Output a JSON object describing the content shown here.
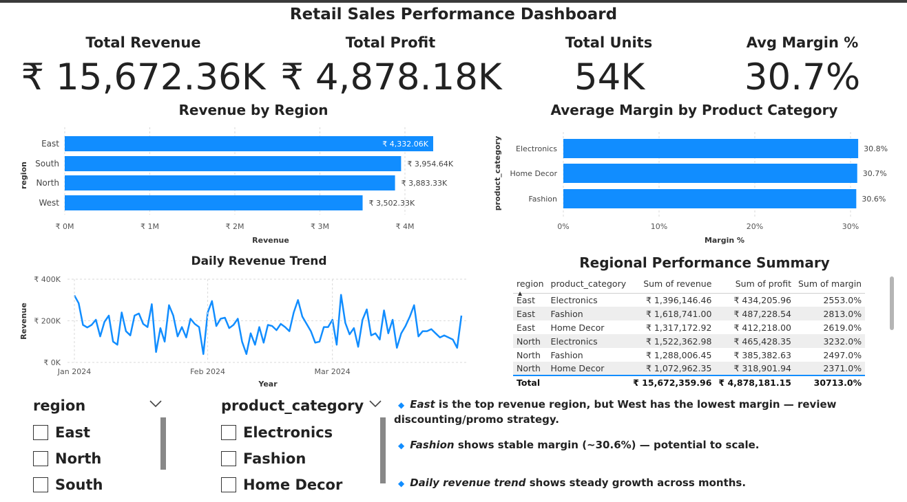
{
  "dashboard_title": "Retail Sales Performance Dashboard",
  "kpis": [
    {
      "label": "Total Revenue",
      "value": "₹ 15,672.36K"
    },
    {
      "label": "Total Profit",
      "value": "₹ 4,878.18K"
    },
    {
      "label": "Total Units",
      "value": "54K"
    },
    {
      "label": "Avg Margin %",
      "value": "30.7%"
    }
  ],
  "colors": {
    "accent": "#118DFF",
    "text": "#222222",
    "grid": "#d9d9d9",
    "band": "#eeeeee"
  },
  "charts": {
    "region": {
      "title": "Revenue by Region",
      "ylabel": "region",
      "xlabel": "Revenue",
      "x_ticks": [
        "₹ 0M",
        "₹ 1M",
        "₹ 2M",
        "₹ 3M",
        "₹ 4M"
      ],
      "bar_labels": [
        "₹ 4,332.06K",
        "₹ 3,954.64K",
        "₹ 3,883.33K",
        "₹ 3,502.33K"
      ]
    },
    "margin": {
      "title": "Average Margin by Product Category",
      "ylabel": "product_category",
      "xlabel": "Margin %",
      "x_ticks": [
        "0%",
        "10%",
        "20%",
        "30%"
      ],
      "bar_labels": [
        "30.8%",
        "30.7%",
        "30.6%"
      ]
    },
    "trend": {
      "title": "Daily Revenue Trend",
      "ylabel": "Revenue",
      "xlabel": "Year",
      "y_ticks": [
        "₹ 400K",
        "₹ 200K",
        "₹ 0K"
      ],
      "x_ticks": [
        "Jan 2024",
        "Feb 2024",
        "Mar 2024"
      ]
    }
  },
  "chart_data": [
    {
      "type": "bar",
      "orientation": "horizontal",
      "title": "Revenue by Region",
      "xlabel": "Revenue",
      "ylabel": "region",
      "categories": [
        "East",
        "South",
        "North",
        "West"
      ],
      "values": [
        4332.06,
        3954.64,
        3883.33,
        3502.33
      ],
      "unit": "₹ K",
      "xlim": [
        0,
        4500
      ],
      "grid": true
    },
    {
      "type": "bar",
      "orientation": "horizontal",
      "title": "Average Margin by Product Category",
      "xlabel": "Margin %",
      "ylabel": "product_category",
      "categories": [
        "Electronics",
        "Home Decor",
        "Fashion"
      ],
      "values": [
        30.8,
        30.7,
        30.6
      ],
      "xlim": [
        0,
        31
      ],
      "grid": true
    },
    {
      "type": "line",
      "title": "Daily Revenue Trend",
      "xlabel": "Year",
      "ylabel": "Revenue",
      "x": [
        "2024-01-01",
        "2024-01-02",
        "2024-01-03",
        "2024-01-04",
        "2024-01-05",
        "2024-01-06",
        "2024-01-07",
        "2024-01-08",
        "2024-01-09",
        "2024-01-10",
        "2024-01-11",
        "2024-01-12",
        "2024-01-13",
        "2024-01-14",
        "2024-01-15",
        "2024-01-16",
        "2024-01-17",
        "2024-01-18",
        "2024-01-19",
        "2024-01-20",
        "2024-01-21",
        "2024-01-22",
        "2024-01-23",
        "2024-01-24",
        "2024-01-25",
        "2024-01-26",
        "2024-01-27",
        "2024-01-28",
        "2024-01-29",
        "2024-01-30",
        "2024-01-31",
        "2024-02-01",
        "2024-02-02",
        "2024-02-03",
        "2024-02-04",
        "2024-02-05",
        "2024-02-06",
        "2024-02-07",
        "2024-02-08",
        "2024-02-09",
        "2024-02-10",
        "2024-02-11",
        "2024-02-12",
        "2024-02-13",
        "2024-02-14",
        "2024-02-15",
        "2024-02-16",
        "2024-02-17",
        "2024-02-18",
        "2024-02-19",
        "2024-02-20",
        "2024-02-21",
        "2024-02-22",
        "2024-02-23",
        "2024-02-24",
        "2024-02-25",
        "2024-02-26",
        "2024-02-27",
        "2024-02-28",
        "2024-02-29",
        "2024-03-01",
        "2024-03-02",
        "2024-03-03",
        "2024-03-04",
        "2024-03-05",
        "2024-03-06",
        "2024-03-07",
        "2024-03-08",
        "2024-03-09",
        "2024-03-10",
        "2024-03-11",
        "2024-03-12",
        "2024-03-13",
        "2024-03-14",
        "2024-03-15",
        "2024-03-16",
        "2024-03-17",
        "2024-03-18",
        "2024-03-19",
        "2024-03-20",
        "2024-03-21",
        "2024-03-22",
        "2024-03-23",
        "2024-03-24",
        "2024-03-25",
        "2024-03-26",
        "2024-03-27",
        "2024-03-28",
        "2024-03-29",
        "2024-03-30",
        "2024-03-31"
      ],
      "y": [
        322,
        285,
        180,
        168,
        180,
        205,
        125,
        195,
        225,
        100,
        85,
        240,
        150,
        130,
        225,
        235,
        185,
        170,
        280,
        50,
        165,
        100,
        275,
        225,
        125,
        170,
        120,
        210,
        185,
        170,
        40,
        240,
        295,
        175,
        210,
        215,
        165,
        180,
        210,
        100,
        40,
        140,
        85,
        170,
        95,
        180,
        175,
        155,
        185,
        170,
        150,
        240,
        300,
        220,
        185,
        150,
        95,
        100,
        170,
        170,
        205,
        85,
        325,
        190,
        135,
        165,
        75,
        205,
        255,
        130,
        140,
        110,
        250,
        140,
        205,
        70,
        140,
        175,
        220,
        275,
        125,
        150,
        150,
        160,
        140,
        120,
        130,
        120,
        110,
        70,
        225,
        130,
        155,
        90,
        265,
        140,
        165,
        270,
        320
      ],
      "ylim": [
        0,
        400
      ],
      "y_unit": "₹ K",
      "grid": true
    },
    {
      "type": "table",
      "title": "Regional Performance Summary",
      "columns": [
        "region",
        "product_category",
        "Sum of revenue",
        "Sum of profit",
        "Sum of margin"
      ],
      "rows": [
        [
          "East",
          "Electronics",
          "₹ 1,396,146.46",
          "₹ 434,205.96",
          "2553.0%"
        ],
        [
          "East",
          "Fashion",
          "₹ 1,618,741.00",
          "₹ 487,228.54",
          "2813.0%"
        ],
        [
          "East",
          "Home Decor",
          "₹ 1,317,172.92",
          "₹ 412,218.00",
          "2619.0%"
        ],
        [
          "North",
          "Electronics",
          "₹ 1,522,362.98",
          "₹ 465,428.35",
          "3232.0%"
        ],
        [
          "North",
          "Fashion",
          "₹ 1,288,006.45",
          "₹ 385,382.63",
          "2497.0%"
        ],
        [
          "North",
          "Home Decor",
          "₹ 1,072,962.35",
          "₹ 318,901.94",
          "2371.0%"
        ]
      ],
      "total": [
        "Total",
        "",
        "₹ 15,672,359.96",
        "₹ 4,878,181.15",
        "30713.0%"
      ]
    }
  ],
  "table": {
    "title": "Regional Performance Summary",
    "columns": [
      "region",
      "product_category",
      "Sum of revenue",
      "Sum of profit",
      "Sum of margin"
    ],
    "rows": [
      [
        "East",
        "Electronics",
        "₹ 1,396,146.46",
        "₹ 434,205.96",
        "2553.0%"
      ],
      [
        "East",
        "Fashion",
        "₹ 1,618,741.00",
        "₹ 487,228.54",
        "2813.0%"
      ],
      [
        "East",
        "Home Decor",
        "₹ 1,317,172.92",
        "₹ 412,218.00",
        "2619.0%"
      ],
      [
        "North",
        "Electronics",
        "₹ 1,522,362.98",
        "₹ 465,428.35",
        "3232.0%"
      ],
      [
        "North",
        "Fashion",
        "₹ 1,288,006.45",
        "₹ 385,382.63",
        "2497.0%"
      ],
      [
        "North",
        "Home Decor",
        "₹ 1,072,962.35",
        "₹ 318,901.94",
        "2371.0%"
      ]
    ],
    "total": [
      "Total",
      "",
      "₹ 15,672,359.96",
      "₹ 4,878,181.15",
      "30713.0%"
    ]
  },
  "slicers": {
    "region": {
      "title": "region",
      "items": [
        "East",
        "North",
        "South"
      ]
    },
    "category": {
      "title": "product_category",
      "items": [
        "Electronics",
        "Fashion",
        "Home Decor"
      ]
    }
  },
  "insights": [
    {
      "em": "East",
      "text": " is the top revenue region, but West has the lowest margin — review discounting/promo strategy."
    },
    {
      "em": "Fashion",
      "text": " shows stable margin (~30.6%) — potential to scale."
    },
    {
      "em": "Daily revenue trend",
      "text": " shows steady growth across months."
    }
  ]
}
